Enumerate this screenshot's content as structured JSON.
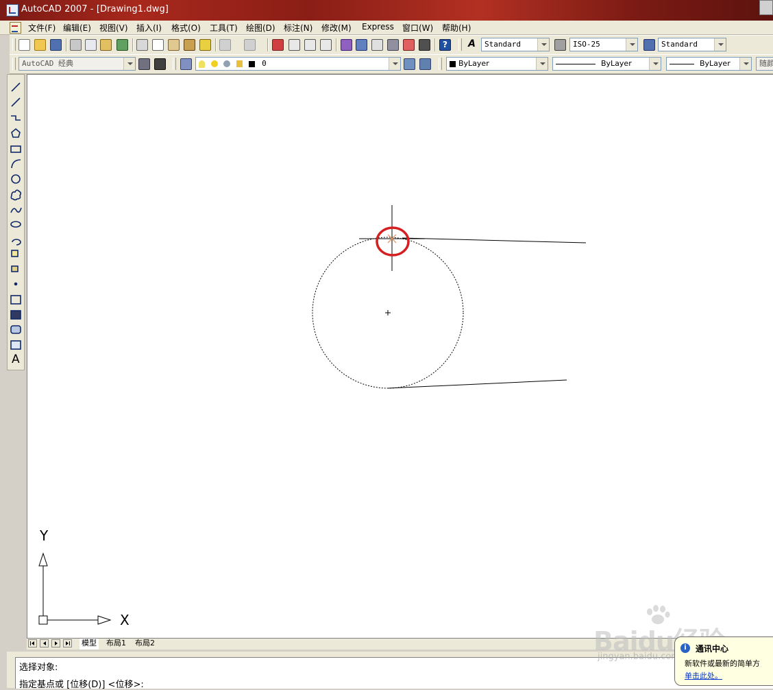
{
  "window": {
    "title": "AutoCAD 2007 - [Drawing1.dwg]"
  },
  "menu": {
    "items": [
      "文件(F)",
      "编辑(E)",
      "视图(V)",
      "插入(I)",
      "格式(O)",
      "工具(T)",
      "绘图(D)",
      "标注(N)",
      "修改(M)",
      "Express",
      "窗口(W)",
      "帮助(H)"
    ]
  },
  "styles_toolbar": {
    "text_style": "Standard",
    "dim_style": "ISO-25",
    "table_style": "Standard"
  },
  "workspace_toolbar": {
    "workspace": "AutoCAD 经典"
  },
  "layers_toolbar": {
    "current_layer": "0"
  },
  "properties_toolbar": {
    "color": "ByLayer",
    "linetype": "ByLayer",
    "lineweight": "ByLayer",
    "plot_style": "随颜"
  },
  "draw_toolbar": {
    "tools": [
      "line-icon",
      "construction-line-icon",
      "polyline-icon",
      "polygon-icon",
      "rectangle-icon",
      "arc-icon",
      "circle-icon",
      "revision-cloud-icon",
      "spline-icon",
      "ellipse-icon",
      "ellipse-arc-icon",
      "insert-block-icon",
      "make-block-icon",
      "point-icon",
      "hatch-icon",
      "gradient-icon",
      "region-icon",
      "table-icon",
      "multiline-text-icon"
    ],
    "text_tool_glyph": "A"
  },
  "drawing": {
    "highlight_color": "#d42020",
    "marker_color": "#e8a070",
    "ucs": {
      "x_label": "X",
      "y_label": "Y"
    }
  },
  "layout_tabs": {
    "tabs": [
      "模型",
      "布局1",
      "布局2"
    ],
    "active": "模型"
  },
  "command_line": {
    "line1": "选择对象:",
    "line2": "指定基点或 [位移(D)] <位移>:"
  },
  "notification": {
    "title": "通讯中心",
    "text": "新软件或最新的简单方",
    "link": "单击此处。"
  },
  "watermark": {
    "text": "Baidu经验",
    "sub": "jingyan.baidu.com"
  }
}
